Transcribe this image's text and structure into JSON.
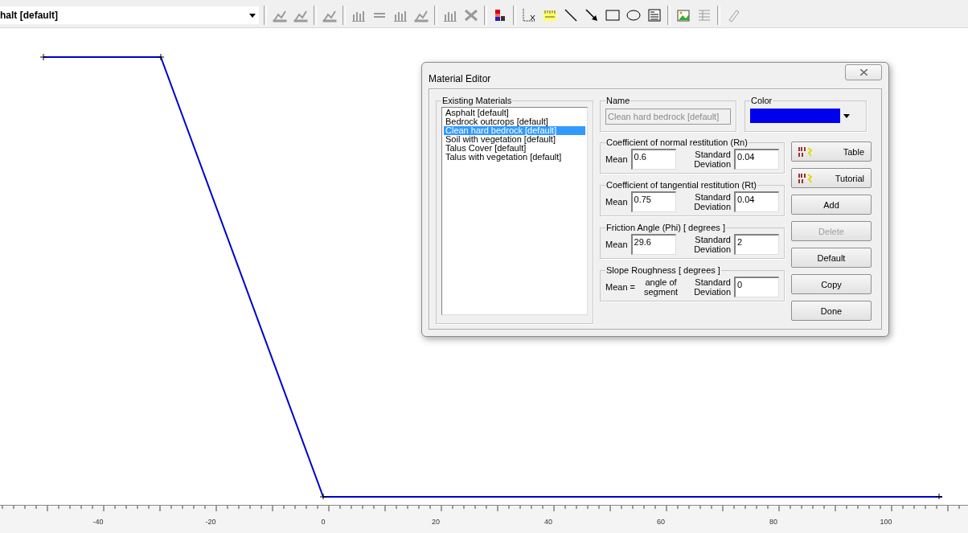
{
  "toolbar": {
    "material_select": "halt [default]"
  },
  "ruler": {
    "ticks": [
      "-40",
      "-20",
      "0",
      "20",
      "40",
      "60",
      "80",
      "100"
    ]
  },
  "dialog": {
    "title": "Material Editor",
    "materials": {
      "label": "Existing Materials",
      "items": [
        {
          "label": "Asphalt [default]",
          "selected": false
        },
        {
          "label": "Bedrock outcrops [default]",
          "selected": false
        },
        {
          "label": "Clean hard bedrock [default]",
          "selected": true
        },
        {
          "label": "Soil with vegetation [default]",
          "selected": false
        },
        {
          "label": "Talus Cover [default]",
          "selected": false
        },
        {
          "label": "Talus with vegetation [default]",
          "selected": false
        }
      ]
    },
    "name": {
      "label": "Name",
      "value": "Clean hard bedrock [default]",
      "disabled": true
    },
    "color": {
      "label": "Color",
      "color": "#0000ee"
    },
    "groups": [
      {
        "title": "Coefficient of normal restitution (Rn)",
        "kind": "field",
        "mean_label": "Mean",
        "mean": "0.6",
        "sd_label": "Standard Deviation",
        "sd": "0.04"
      },
      {
        "title": "Coefficient of tangential restitution (Rt)",
        "kind": "field",
        "mean_label": "Mean",
        "mean": "0.75",
        "sd_label": "Standard Deviation",
        "sd": "0.04"
      },
      {
        "title": "Friction Angle (Phi) [ degrees ]",
        "kind": "field",
        "mean_label": "Mean",
        "mean": "29.6",
        "sd_label": "Standard Deviation",
        "sd": "2"
      },
      {
        "title": "Slope Roughness [ degrees ]",
        "kind": "text",
        "mean_label": "Mean =",
        "mean": "angle of segment",
        "sd_label": "Standard Deviation",
        "sd": "0"
      }
    ],
    "buttons": [
      {
        "label": "Table",
        "kind": "rnrt",
        "disabled": false
      },
      {
        "label": "Tutorial",
        "kind": "rnrt",
        "disabled": false
      },
      {
        "label": "Add",
        "kind": "plain",
        "disabled": false
      },
      {
        "label": "Delete",
        "kind": "plain",
        "disabled": true
      },
      {
        "label": "Default",
        "kind": "plain",
        "disabled": false
      },
      {
        "label": "Copy",
        "kind": "plain",
        "disabled": false
      },
      {
        "label": "Done",
        "kind": "plain",
        "disabled": false
      }
    ]
  }
}
